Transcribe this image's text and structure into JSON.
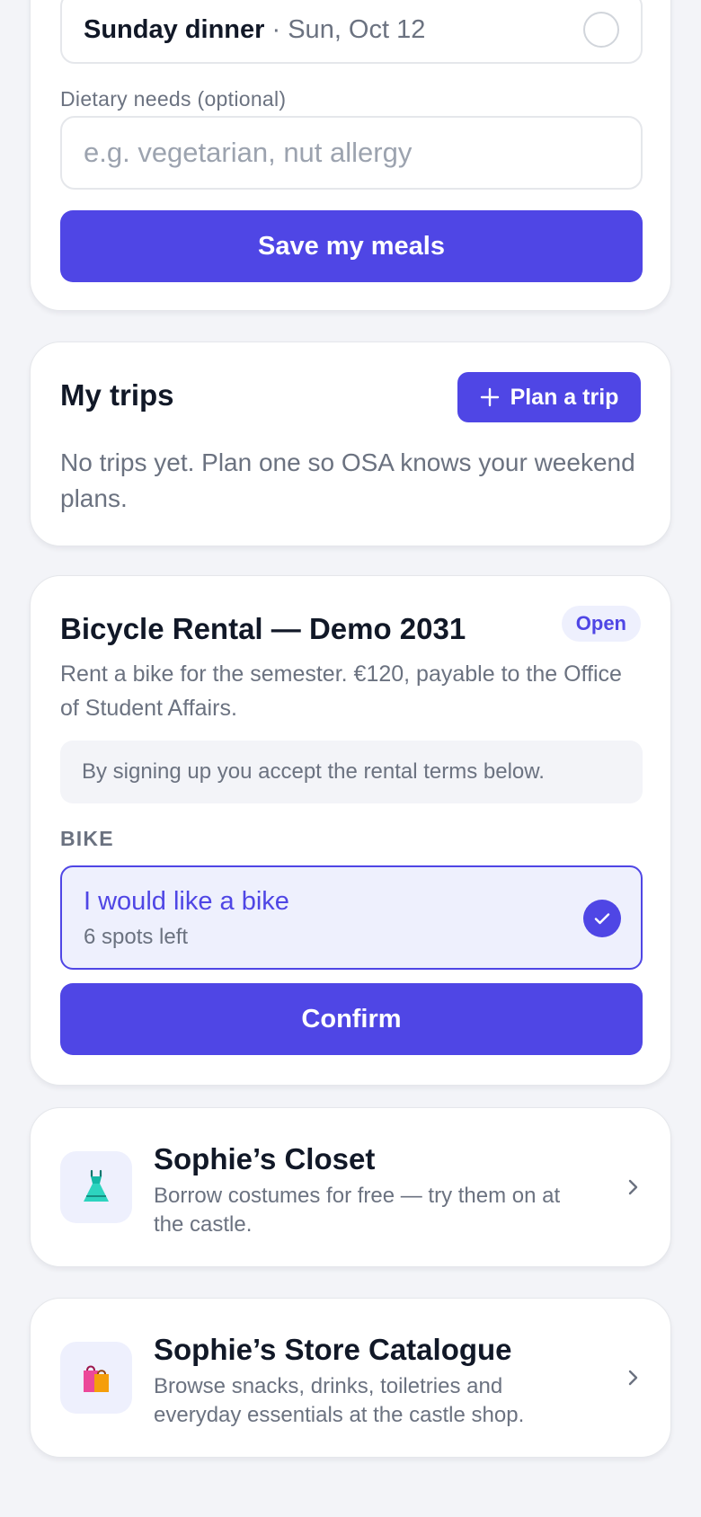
{
  "meals": {
    "selected_meal": {
      "name": "Sunday dinner",
      "separator": "·",
      "date": "Sun, Oct 12"
    },
    "dietary_label": "Dietary needs (optional)",
    "dietary_placeholder": "e.g. vegetarian, nut allergy",
    "dietary_value": "",
    "save_label": "Save my meals"
  },
  "trips": {
    "title": "My trips",
    "plan_label": "Plan a trip",
    "empty_text": "No trips yet. Plan one so OSA knows your weekend plans."
  },
  "bicycle": {
    "title": "Bicycle Rental — Demo 2031",
    "status": "Open",
    "description": "Rent a bike for the semester. €120, payable to the Office of Student Affairs.",
    "terms_note": "By signing up you accept the rental terms below.",
    "section_label": "BIKE",
    "option": {
      "title": "I would like a bike",
      "subtitle": "6 spots left",
      "selected": true
    },
    "confirm_label": "Confirm"
  },
  "list": [
    {
      "icon": "dress-icon",
      "title": "Sophie’s Closet",
      "description": "Borrow costumes for free — try them on at the castle."
    },
    {
      "icon": "shopping-bags-icon",
      "title": "Sophie’s Store Catalogue",
      "description": "Browse snacks, drinks, toiletries and everyday essentials at the castle shop."
    }
  ],
  "colors": {
    "accent": "#4f46e5",
    "accent_light": "#eef0fd",
    "background": "#f3f4f8",
    "muted_text": "#6b7280"
  }
}
